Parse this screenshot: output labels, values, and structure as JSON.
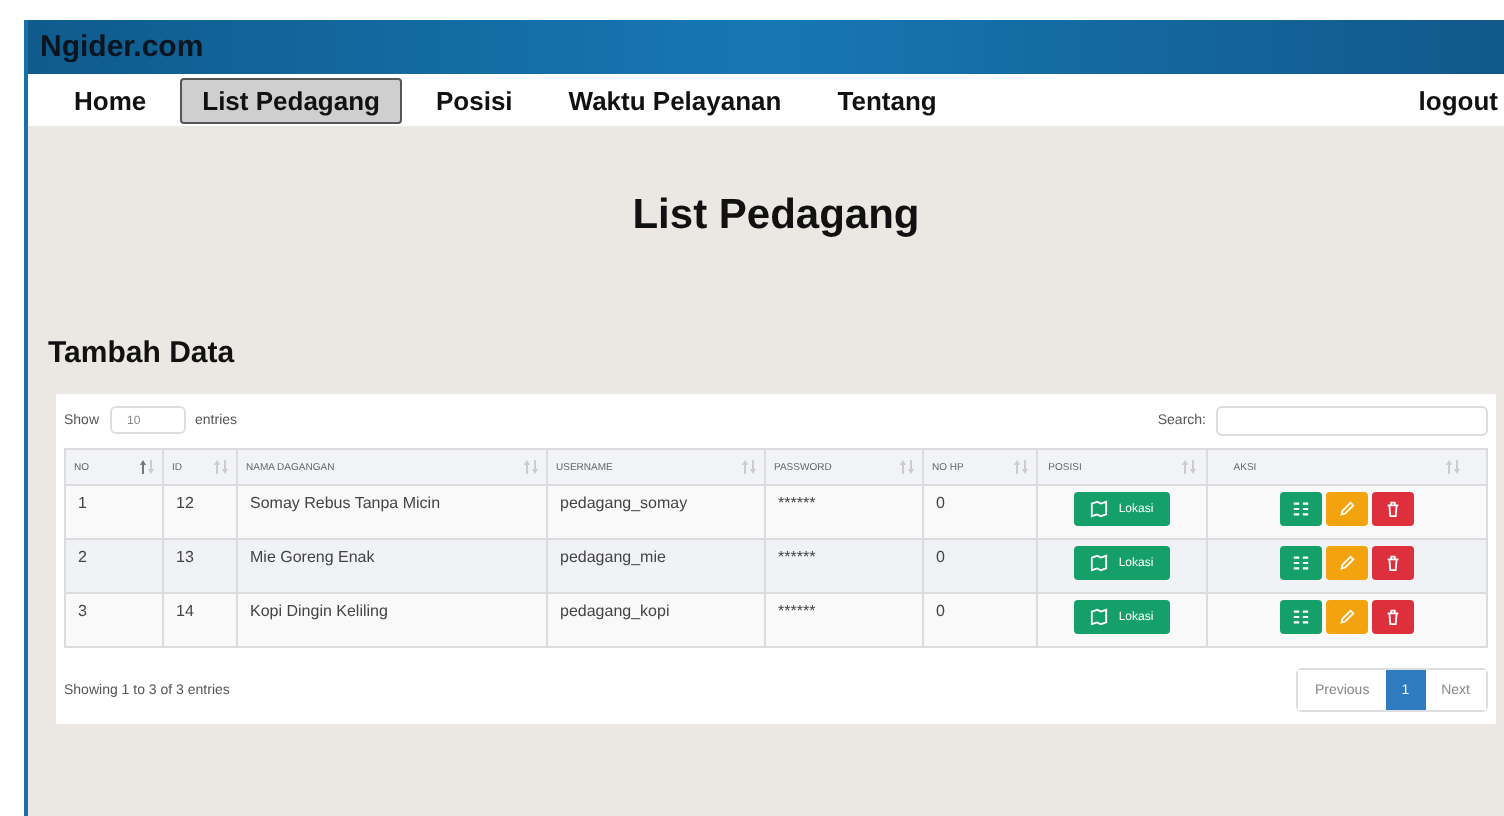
{
  "site_title": "Ngider.com",
  "nav": [
    {
      "label": "Home",
      "selected": false
    },
    {
      "label": "List Pedagang",
      "selected": true
    },
    {
      "label": "Posisi",
      "selected": false
    },
    {
      "label": "Waktu Pelayanan",
      "selected": false
    },
    {
      "label": "Tentang",
      "selected": false
    }
  ],
  "logout": "logout",
  "heading": "List Pedagang",
  "add_link": "Tambah Data",
  "table": {
    "show_label": "Show",
    "page_size": "10",
    "entries_label": "entries",
    "search_label": "Search:",
    "columns": [
      {
        "label": "NO",
        "sorted": true
      },
      {
        "label": "ID",
        "sorted": false
      },
      {
        "label": "NAMA DAGANGAN",
        "sorted": false
      },
      {
        "label": "USERNAME",
        "sorted": false
      },
      {
        "label": "PASSWORD",
        "sorted": false
      },
      {
        "label": "NO HP",
        "sorted": false
      },
      {
        "label": "POSISI",
        "sorted": false
      },
      {
        "label": "AKSI",
        "sorted": false
      }
    ],
    "rows": [
      {
        "no": "1",
        "id": "12",
        "nama": "Somay Rebus Tanpa Micin",
        "username": "pedagang_somay",
        "password": "******",
        "no_hp": "0",
        "location_button": "Lokasi"
      },
      {
        "no": "2",
        "id": "13",
        "nama": "Mie Goreng Enak",
        "username": "pedagang_mie",
        "password": "******",
        "no_hp": "0",
        "location_button": "Lokasi"
      },
      {
        "no": "3",
        "id": "14",
        "nama": "Kopi Dingin Keliling",
        "username": "pedagang_kopi",
        "password": "******",
        "no_hp": "0",
        "location_button": "Lokasi"
      }
    ],
    "info": "Showing 1 to 3 of 3 entries",
    "pagination": [
      {
        "label": "Previous",
        "selected": false
      },
      {
        "label": "1",
        "selected": true
      },
      {
        "label": "Next",
        "selected": false
      }
    ]
  }
}
